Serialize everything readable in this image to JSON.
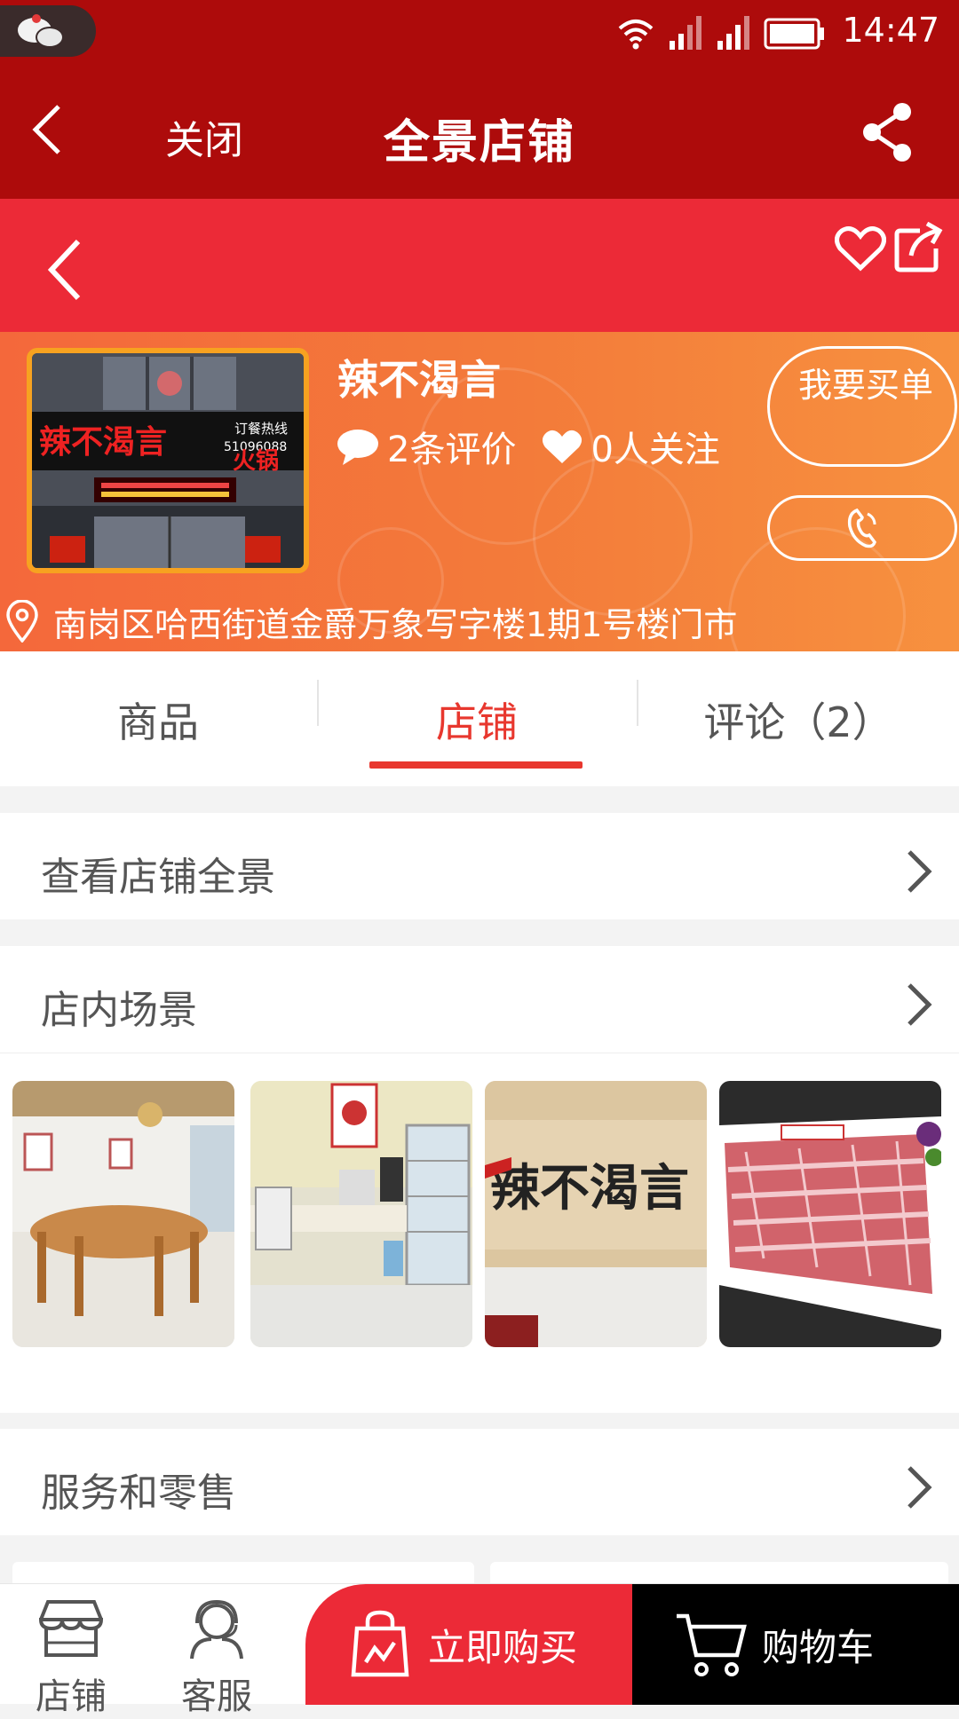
{
  "status_bar": {
    "time": "14:47"
  },
  "title_bar": {
    "close_label": "关闭",
    "title": "全景店铺"
  },
  "store": {
    "name": "辣不渴言",
    "reviews": "2条评价",
    "follows": "0人关注",
    "buy_button": "我要买单",
    "address": "南岗区哈西街道金爵万象写字楼1期1号楼门市",
    "photo_sign_text": "辣不渴言",
    "photo_sign_sub": "火锅",
    "photo_hotline_label": "订餐热线",
    "photo_hotline_number": "51096088"
  },
  "tabs": [
    {
      "label": "商品"
    },
    {
      "label": "店铺"
    },
    {
      "label": "评论（2）"
    }
  ],
  "sections": {
    "panorama": "查看店铺全景",
    "scenes": "店内场景",
    "services": "服务和零售"
  },
  "scene_images": [
    {
      "name": "dining-room"
    },
    {
      "name": "counter-and-fridge"
    },
    {
      "name": "wall-logo",
      "text": "辣不渴言"
    },
    {
      "name": "sliced-meat"
    }
  ],
  "bottom_bar": {
    "store_label": "店铺",
    "service_label": "客服",
    "buy_now_label": "立即购买",
    "cart_label": "购物车"
  },
  "colors": {
    "status_bar": "#ad0b0b",
    "store_nav": "#ec2a37",
    "accent": "#e8372e",
    "header_gradient_start": "#f4683b",
    "header_gradient_end": "#f7913f"
  },
  "icons": [
    "back-arrow-icon",
    "share-icon",
    "heart-outline-icon",
    "export-icon",
    "comment-icon",
    "heart-icon",
    "phone-icon",
    "location-pin-icon",
    "chevron-right-icon",
    "store-icon",
    "customer-service-icon",
    "shopping-bag-icon",
    "cart-icon"
  ]
}
